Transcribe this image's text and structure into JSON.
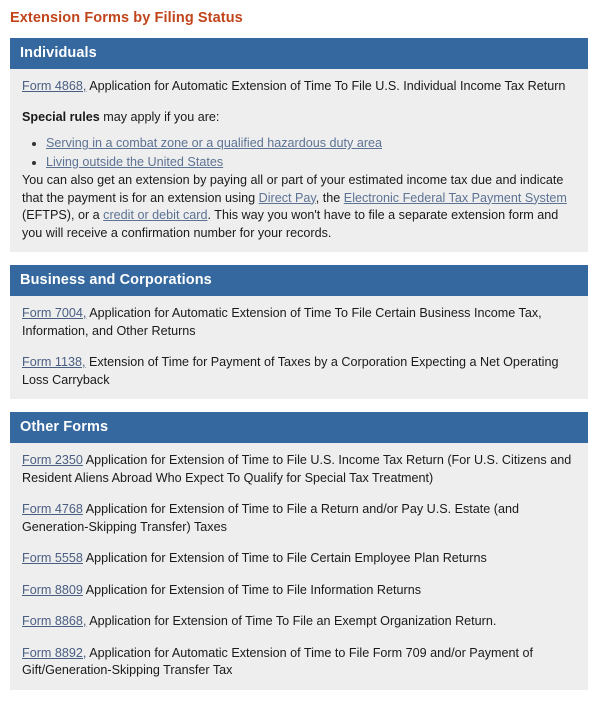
{
  "page": {
    "title": "Extension Forms by Filing Status"
  },
  "sections": [
    {
      "id": "individuals",
      "heading": "Individuals",
      "entries": [
        {
          "link": "Form 4868,",
          "text": " Application for Automatic Extension of Time To File U.S. Individual Income Tax Return"
        }
      ],
      "special_rules": {
        "lead_bold": "Special rules",
        "lead_rest": " may apply if you are:",
        "items": [
          "Serving in a combat zone or a qualified hazardous duty area",
          "Living outside the United States"
        ]
      },
      "payment_paragraph": {
        "part1": "You can also get an extension by paying all or part of your estimated income tax due and indicate that the payment is for an extension using ",
        "link1": "Direct Pay",
        "part2": ", the ",
        "link2": "Electronic Federal Tax Payment System",
        "part3": " (EFTPS), or a ",
        "link3": "credit or debit card",
        "part4": ". This way you won't have to file a separate extension form and you will receive a confirmation number for your records."
      }
    },
    {
      "id": "business-and-corporations",
      "heading": "Business and Corporations",
      "entries": [
        {
          "link": "Form 7004,",
          "text": " Application for Automatic Extension of Time To File Certain Business Income Tax, Information, and Other Returns"
        },
        {
          "link": "Form 1138,",
          "text": " Extension of Time for Payment of Taxes by a Corporation Expecting a Net Operating Loss Carryback"
        }
      ]
    },
    {
      "id": "other-forms",
      "heading": "Other Forms",
      "entries": [
        {
          "link": "Form 2350",
          "text": " Application for Extension of Time to File U.S. Income Tax Return (For U.S. Citizens and Resident Aliens Abroad Who Expect To Qualify for Special Tax Treatment)"
        },
        {
          "link": "Form 4768",
          "text": " Application for Extension of Time to File a Return and/or Pay U.S. Estate (and Generation-Skipping Transfer) Taxes"
        },
        {
          "link": "Form 5558",
          "text": " Application for Extension of Time to File Certain Employee Plan Returns"
        },
        {
          "link": "Form 8809",
          "text": " Application for Extension of Time to File Information Returns"
        },
        {
          "link": "Form 8868,",
          "text": " Application for Extension of Time To File an Exempt Organization Return."
        },
        {
          "link": "Form 8892,",
          "text": " Application for Automatic Extension of Time to File Form 709 and/or Payment of Gift/Generation-Skipping Transfer Tax"
        }
      ]
    }
  ],
  "colors": {
    "title": "#c1451b",
    "header_bar": "#34689f",
    "body_bg": "#eeeeee",
    "link": "#4a5e82",
    "inline_link": "#5d7394"
  }
}
